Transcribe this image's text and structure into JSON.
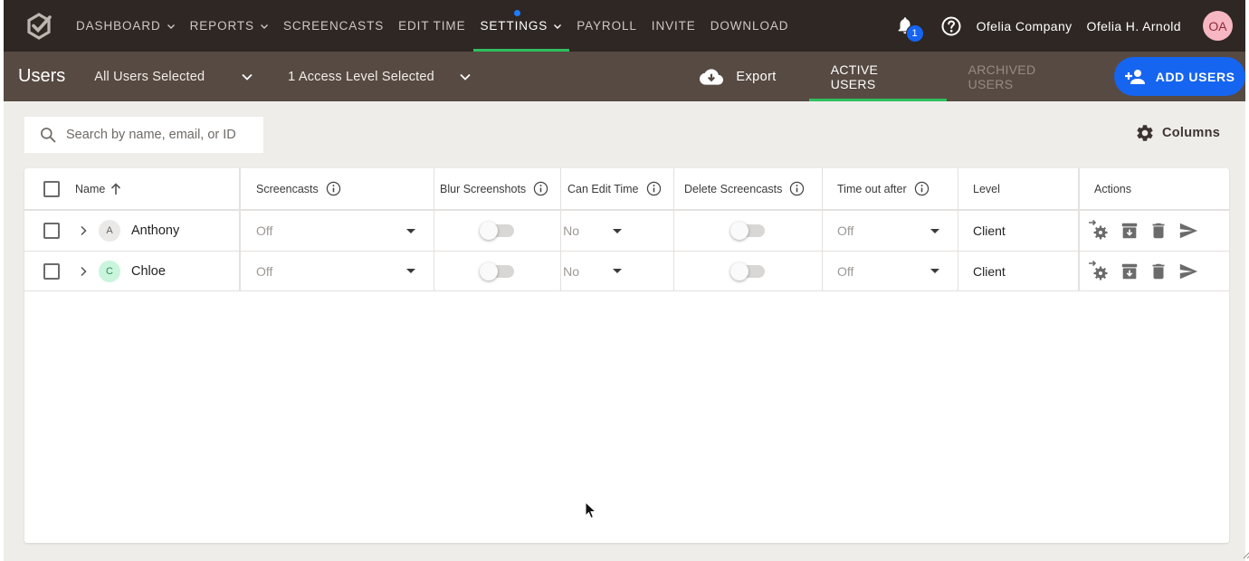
{
  "nav": {
    "items": [
      {
        "label": "DASHBOARD",
        "has_dropdown": true
      },
      {
        "label": "REPORTS",
        "has_dropdown": true
      },
      {
        "label": "SCREENCASTS",
        "has_dropdown": false
      },
      {
        "label": "EDIT TIME",
        "has_dropdown": false
      },
      {
        "label": "SETTINGS",
        "has_dropdown": true,
        "active": true
      },
      {
        "label": "PAYROLL",
        "has_dropdown": false
      },
      {
        "label": "INVITE",
        "has_dropdown": false
      },
      {
        "label": "DOWNLOAD",
        "has_dropdown": false
      }
    ],
    "notification_count": "1",
    "company": "Ofelia Company",
    "user_name": "Ofelia H. Arnold",
    "user_initials": "OA"
  },
  "subheader": {
    "title": "Users",
    "users_filter": "All Users Selected",
    "access_filter": "1 Access Level Selected",
    "export_label": "Export",
    "tab_active": "ACTIVE USERS",
    "tab_archived": "ARCHIVED USERS",
    "add_users_label": "ADD USERS"
  },
  "search": {
    "placeholder": "Search by name, email, or ID"
  },
  "columns_label": "Columns",
  "table": {
    "headers": {
      "name": "Name",
      "screencasts": "Screencasts",
      "blur": "Blur Screenshots",
      "edit_time": "Can Edit Time",
      "delete": "Delete Screencasts",
      "timeout": "Time out after",
      "level": "Level",
      "actions": "Actions"
    },
    "rows": [
      {
        "initial": "A",
        "name": "Anthony",
        "screencasts": "Off",
        "blur": false,
        "edit_time": "No",
        "delete": false,
        "timeout": "Off",
        "level": "Client"
      },
      {
        "initial": "C",
        "name": "Chloe",
        "screencasts": "Off",
        "blur": false,
        "edit_time": "No",
        "delete": false,
        "timeout": "Off",
        "level": "Client"
      }
    ]
  },
  "colors": {
    "topbar": "#2f2723",
    "subbar": "#574a42",
    "accent_blue": "#1565f0",
    "active_underline": "#2fbf5f",
    "avatar_bg": "#f7b7c2"
  }
}
